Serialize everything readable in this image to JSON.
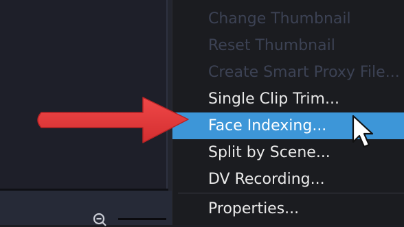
{
  "context_menu": {
    "items": [
      {
        "label": "Change Thumbnail",
        "enabled": false,
        "selected": false
      },
      {
        "label": "Reset Thumbnail",
        "enabled": false,
        "selected": false
      },
      {
        "label": "Create Smart Proxy File...",
        "enabled": false,
        "selected": false
      },
      {
        "label": "Single Clip Trim...",
        "enabled": true,
        "selected": false
      },
      {
        "label": "Face Indexing...",
        "enabled": true,
        "selected": true
      },
      {
        "label": "Split by Scene...",
        "enabled": true,
        "selected": false
      },
      {
        "label": "DV Recording...",
        "enabled": true,
        "selected": false
      },
      {
        "label": "Properties...",
        "enabled": true,
        "selected": false
      }
    ]
  },
  "timeline": {
    "zoom_icon": "zoom-out-icon"
  },
  "annotation": {
    "arrow_color": "#e8393a",
    "arrow_icon": "red-arrow",
    "cursor_icon": "mouse-pointer-icon"
  },
  "colors": {
    "highlight": "#3d96d8",
    "menu_bg": "#1b1c20",
    "disabled_text": "#3c4254"
  }
}
